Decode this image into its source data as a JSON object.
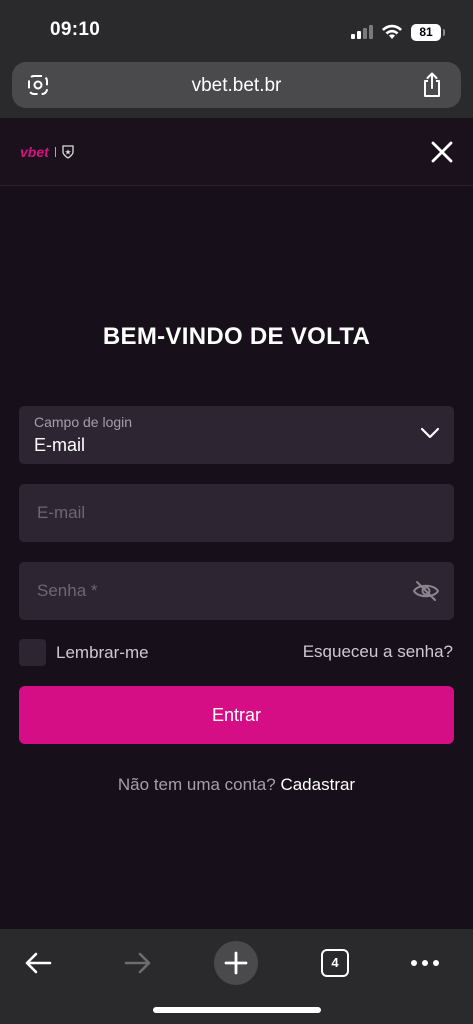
{
  "status": {
    "time": "09:10",
    "battery": "81"
  },
  "browser": {
    "url": "vbet.bet.br",
    "tab_count": "4"
  },
  "site": {
    "logo": "vbet"
  },
  "login": {
    "title": "BEM-VINDO DE VOLTA",
    "login_field_label": "Campo de login",
    "login_field_value": "E-mail",
    "email_placeholder": "E-mail",
    "password_placeholder": "Senha *",
    "remember_label": "Lembrar-me",
    "forgot_link": "Esqueceu a senha?",
    "submit_label": "Entrar",
    "no_account_text": "Não tem uma conta?",
    "signup_link": "Cadastrar"
  },
  "colors": {
    "accent": "#d60e86",
    "background": "#170f19",
    "field": "#2d2531"
  }
}
